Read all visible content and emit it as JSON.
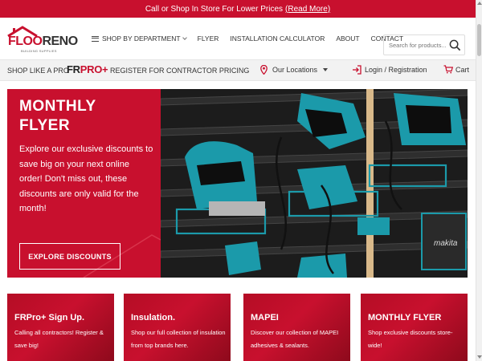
{
  "promo_bar": {
    "text": "Call or Shop In Store For Lower Prices",
    "link": "(Read More)"
  },
  "logo": {
    "part1": "FLOO",
    "part2": "RENO",
    "tagline": "BUILDING SUPPLIES"
  },
  "nav": {
    "shop_by_department": "SHOP BY DEPARTMENT",
    "flyer": "FLYER",
    "installation_calculator": "INSTALLATION CALCULATOR",
    "about": "ABOUT",
    "contact": "CONTACT"
  },
  "search": {
    "placeholder": "Search for products..."
  },
  "subbar": {
    "shop_like": "SHOP LIKE A PRO",
    "frpro_fr": "FR",
    "frpro_pro": "PRO+",
    "register": "REGISTER FOR CONTRACTOR PRICING",
    "locations": "Our Locations",
    "login": "Login / Registration",
    "cart": "Cart"
  },
  "hero": {
    "title_line1": "MONTHLY",
    "title_line2": "FLYER",
    "text": "Explore our exclusive discounts to save big on your next online order! Don't miss out, these discounts are only valid for the month!",
    "button": "EXPLORE DISCOUNTS",
    "image_text": "makita"
  },
  "cards": [
    {
      "title": "FRPro+ Sign Up.",
      "text": "Calling all contractors! Register & save big!"
    },
    {
      "title": "Insulation.",
      "text": "Shop our full collection of insulation from top brands here."
    },
    {
      "title": "MAPEI",
      "text": "Discover our collection of MAPEI adhesives & sealants."
    },
    {
      "title": "MONTHLY FLYER",
      "text": "Shop exclusive discounts store-wide!"
    }
  ],
  "colors": {
    "brand_red": "#c8102e",
    "teal": "#1b9aaa",
    "dark": "#1e1e1e"
  },
  "icons": [
    "hamburger-icon",
    "chevron-down-icon",
    "search-icon",
    "location-pin-icon",
    "login-icon",
    "cart-icon",
    "house-logo-icon"
  ]
}
